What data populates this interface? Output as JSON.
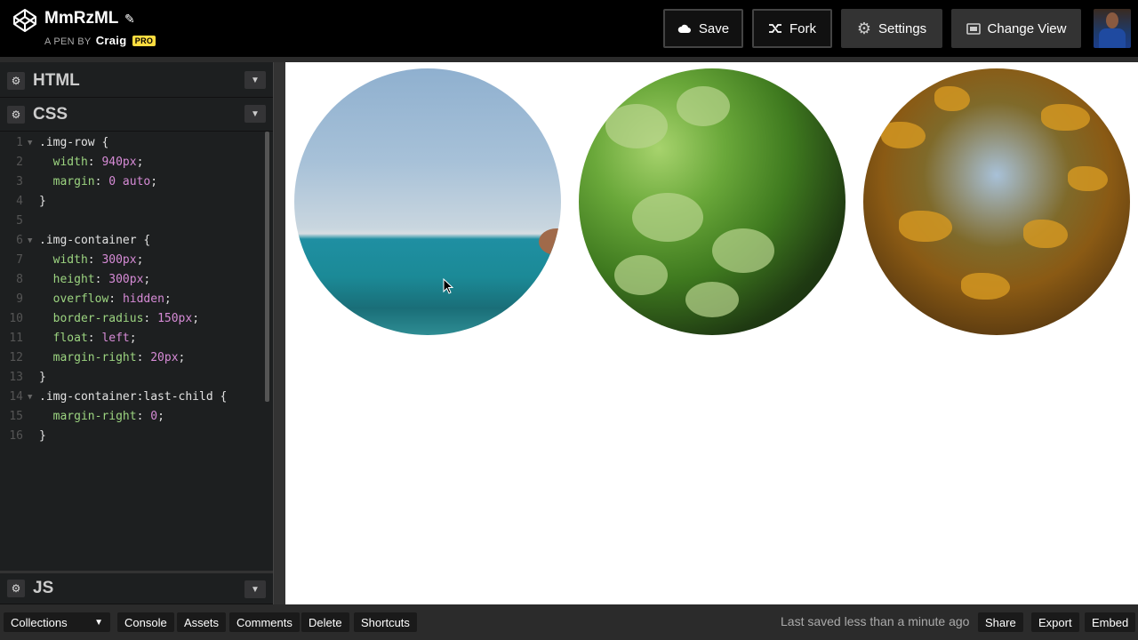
{
  "header": {
    "title": "MmRzML",
    "byline_prefix": "A PEN BY",
    "author": "Craig",
    "badge": "PRO",
    "buttons": {
      "save": "Save",
      "fork": "Fork",
      "settings": "Settings",
      "change_view": "Change View"
    }
  },
  "editors": {
    "html": "HTML",
    "css": "CSS",
    "js": "JS"
  },
  "css_code": [
    {
      "n": "1",
      "fold": true,
      "sel": ".img-row {"
    },
    {
      "n": "2",
      "prop": "width",
      "val": "940px"
    },
    {
      "n": "3",
      "prop": "margin",
      "val": "0 auto"
    },
    {
      "n": "4",
      "sel": "}"
    },
    {
      "n": "5"
    },
    {
      "n": "6",
      "fold": true,
      "sel": ".img-container {"
    },
    {
      "n": "7",
      "prop": "width",
      "val": "300px"
    },
    {
      "n": "8",
      "prop": "height",
      "val": "300px"
    },
    {
      "n": "9",
      "prop": "overflow",
      "val": "hidden"
    },
    {
      "n": "10",
      "prop": "border-radius",
      "val": "150px"
    },
    {
      "n": "11",
      "prop": "float",
      "val": "left"
    },
    {
      "n": "12",
      "prop": "margin-right",
      "val": "20px"
    },
    {
      "n": "13",
      "sel": "}"
    },
    {
      "n": "14",
      "fold": true,
      "sel": ".img-container:last-child {"
    },
    {
      "n": "15",
      "prop": "margin-right",
      "val": "0"
    },
    {
      "n": "16",
      "sel": "}"
    }
  ],
  "preview": {
    "images": [
      "ocean",
      "clover",
      "autumn-tree"
    ]
  },
  "footer": {
    "collections": "Collections",
    "console": "Console",
    "assets": "Assets",
    "comments": "Comments",
    "delete": "Delete",
    "shortcuts": "Shortcuts",
    "last_saved": "Last saved less than a minute ago",
    "share": "Share",
    "export": "Export",
    "embed": "Embed"
  },
  "colors": {
    "pro_badge": "#ffdd40",
    "property": "#9cd480",
    "value": "#d68bd6"
  }
}
